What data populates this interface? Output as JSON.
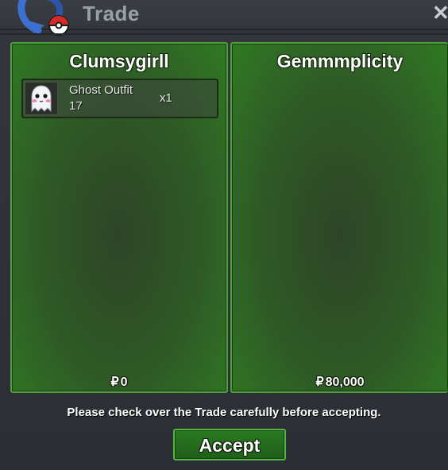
{
  "window": {
    "title": "Trade",
    "close_icon": "close-icon",
    "logo_icon": "pokeball-swirl-icon"
  },
  "left_panel": {
    "player_name": "Clumsygirll",
    "items": [
      {
        "icon": "ghost-outfit-icon",
        "name": "Ghost Outfit",
        "level": "17",
        "quantity": "x1"
      }
    ],
    "money": "0"
  },
  "right_panel": {
    "player_name": "Gemmmplicity",
    "items": [],
    "money": "80,000"
  },
  "currency_symbol": "₽",
  "notice": "Please check over the Trade carefully before accepting.",
  "accept_label": "Accept",
  "colors": {
    "panel_green": "#2f7a22",
    "panel_border": "#4ea23a",
    "accept_button": "#2a7a22",
    "title_text": "#9aa0a8"
  }
}
